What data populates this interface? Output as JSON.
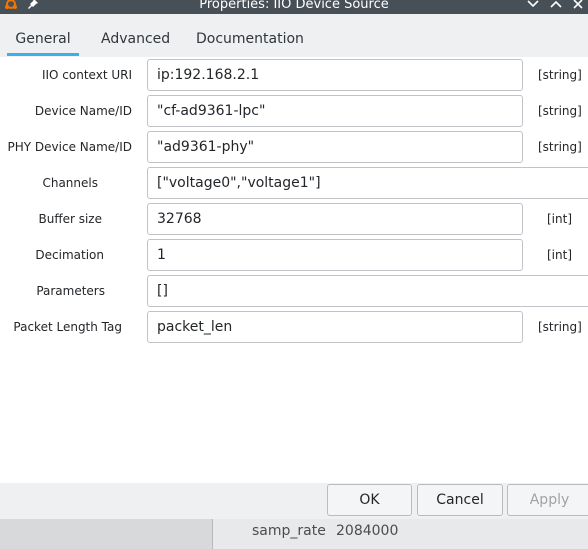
{
  "window": {
    "title": "Properties: IIO Device Source"
  },
  "tabs": [
    {
      "label": "General",
      "active": true
    },
    {
      "label": "Advanced",
      "active": false
    },
    {
      "label": "Documentation",
      "active": false
    }
  ],
  "params": [
    {
      "label": "IIO context URI",
      "value": "ip:192.168.2.1",
      "type": "[string]"
    },
    {
      "label": "Device Name/ID",
      "value": "\"cf-ad9361-lpc\"",
      "type": "[string]"
    },
    {
      "label": "PHY Device Name/ID",
      "value": "\"ad9361-phy\"",
      "type": "[string]"
    },
    {
      "label": "Channels",
      "value": "[\"voltage0\",\"voltage1\"]",
      "type": ""
    },
    {
      "label": "Buffer size",
      "value": "32768",
      "type": "[int]"
    },
    {
      "label": "Decimation",
      "value": "1",
      "type": "[int]"
    },
    {
      "label": "Parameters",
      "value": "[]",
      "type": ""
    },
    {
      "label": "Packet Length Tag",
      "value": "packet_len",
      "type": "[string]"
    }
  ],
  "buttons": {
    "ok": "OK",
    "cancel": "Cancel",
    "apply": "Apply"
  },
  "background": {
    "label": "samp_rate",
    "value": "2084000"
  },
  "colors": {
    "titlebar": "#475057",
    "tab_accent": "#3daee9",
    "app_icon": "#f67400"
  }
}
